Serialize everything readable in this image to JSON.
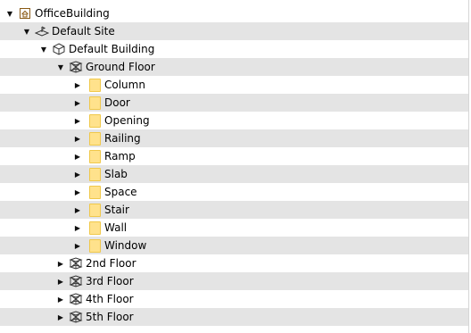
{
  "tree": {
    "root": {
      "label": "OfficeBuilding",
      "toggle": "▼",
      "icon": "building-icon"
    },
    "site": {
      "label": "Default Site",
      "toggle": "▼",
      "icon": "site-icon"
    },
    "building": {
      "label": "Default Building",
      "toggle": "▼",
      "icon": "cube-icon"
    },
    "ground_floor": {
      "label": "Ground Floor",
      "toggle": "▼",
      "icon": "storey-icon"
    },
    "categories": [
      {
        "label": "Column",
        "toggle": "▶",
        "icon": "folder-icon"
      },
      {
        "label": "Door",
        "toggle": "▶",
        "icon": "folder-icon"
      },
      {
        "label": "Opening",
        "toggle": "▶",
        "icon": "folder-icon"
      },
      {
        "label": "Railing",
        "toggle": "▶",
        "icon": "folder-icon"
      },
      {
        "label": "Ramp",
        "toggle": "▶",
        "icon": "folder-icon"
      },
      {
        "label": "Slab",
        "toggle": "▶",
        "icon": "folder-icon"
      },
      {
        "label": "Space",
        "toggle": "▶",
        "icon": "folder-icon"
      },
      {
        "label": "Stair",
        "toggle": "▶",
        "icon": "folder-icon"
      },
      {
        "label": "Wall",
        "toggle": "▶",
        "icon": "folder-icon"
      },
      {
        "label": "Window",
        "toggle": "▶",
        "icon": "folder-icon"
      }
    ],
    "floors": [
      {
        "label": "2nd Floor",
        "toggle": "▶",
        "icon": "storey-icon"
      },
      {
        "label": "3rd Floor",
        "toggle": "▶",
        "icon": "storey-icon"
      },
      {
        "label": "4th Floor",
        "toggle": "▶",
        "icon": "storey-icon"
      },
      {
        "label": "5th Floor",
        "toggle": "▶",
        "icon": "storey-icon"
      }
    ]
  },
  "colors": {
    "row_shade": "#e4e4e4",
    "folder_fill": "#ffe28c",
    "folder_border": "#f0c84a"
  }
}
